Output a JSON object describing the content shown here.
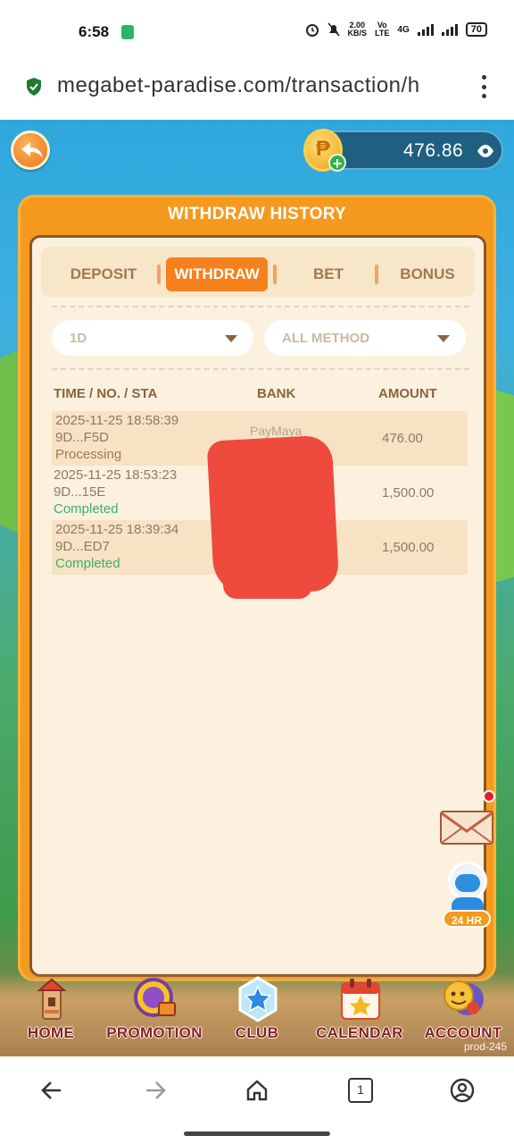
{
  "status_bar": {
    "time": "6:58",
    "speed_value": "2.00",
    "speed_unit": "KB/S",
    "volte_top": "Vo",
    "volte_bottom": "LTE",
    "network": "4G",
    "battery": "70"
  },
  "browser": {
    "url": "megabet-paradise.com/transaction/h",
    "tab_count": "1"
  },
  "header": {
    "balance": "476.86",
    "currency_symbol": "₱",
    "add_symbol": "+"
  },
  "panel": {
    "title": "WITHDRAW HISTORY",
    "tabs": [
      {
        "label": "DEPOSIT",
        "active": false
      },
      {
        "label": "WITHDRAW",
        "active": true
      },
      {
        "label": "BET",
        "active": false
      },
      {
        "label": "BONUS",
        "active": false
      }
    ],
    "filters": {
      "period": "1D",
      "method": "ALL METHOD"
    },
    "columns": [
      "TIME / NO. / STA",
      "BANK",
      "AMOUNT"
    ],
    "rows": [
      {
        "time": "2025-11-25 18:58:39",
        "no": "9D...F5D",
        "status": "Processing",
        "bank": "PayMaya",
        "amount": "476.00"
      },
      {
        "time": "2025-11-25 18:53:23",
        "no": "9D...15E",
        "status": "Completed",
        "bank": "",
        "amount": "1,500.00"
      },
      {
        "time": "2025-11-25 18:39:34",
        "no": "9D...ED7",
        "status": "Completed",
        "bank": "",
        "amount": "1,500.00"
      }
    ]
  },
  "support": {
    "tag": "24 HR"
  },
  "bottom_nav": [
    {
      "label": "HOME",
      "icon": "lighthouse-icon"
    },
    {
      "label": "PROMOTION",
      "icon": "promotion-wheel-icon"
    },
    {
      "label": "CLUB",
      "icon": "club-star-icon"
    },
    {
      "label": "CALENDAR",
      "icon": "calendar-star-icon"
    },
    {
      "label": "ACCOUNT",
      "icon": "avatar-icon"
    }
  ],
  "build_tag": "prod-245",
  "colors": {
    "accent": "#f5811c",
    "panel": "#f59a1e",
    "completed": "#3ab06b"
  }
}
